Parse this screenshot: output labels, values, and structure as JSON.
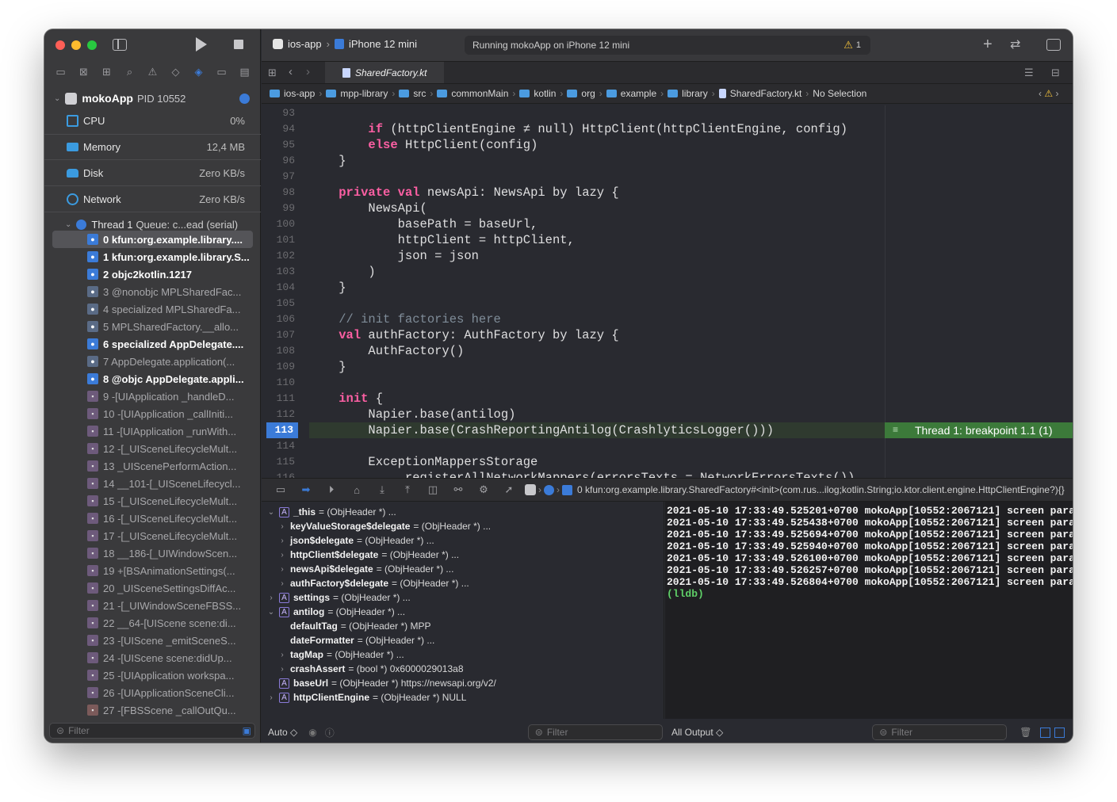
{
  "window": {
    "traffic_lights": {
      "close": "#ff5f57",
      "minimize": "#febc2e",
      "zoom": "#28c840"
    }
  },
  "toolbar": {
    "scheme": "ios-app",
    "destination": "iPhone 12 mini",
    "status": "Running mokoApp on iPhone 12 mini",
    "warning_count": "1"
  },
  "tab": {
    "title": "SharedFactory.kt"
  },
  "jumpbar": {
    "crumbs": [
      "ios-app",
      "mpp-library",
      "src",
      "commonMain",
      "kotlin",
      "org",
      "example",
      "library",
      "SharedFactory.kt",
      "No Selection"
    ]
  },
  "navigator": {
    "process_name": "mokoApp",
    "process_pid": "PID 10552",
    "gauges": [
      {
        "label": "CPU",
        "value": "0%"
      },
      {
        "label": "Memory",
        "value": "12,4 MB"
      },
      {
        "label": "Disk",
        "value": "Zero KB/s"
      },
      {
        "label": "Network",
        "value": "Zero KB/s"
      }
    ],
    "thread_label": "Thread 1",
    "thread_queue": "Queue: c...ead (serial)",
    "frames": [
      {
        "text": "0 kfun:org.example.library....",
        "kind": "user",
        "bold": true
      },
      {
        "text": "1 kfun:org.example.library.S...",
        "kind": "user",
        "bold": true
      },
      {
        "text": "2 objc2kotlin.1217",
        "kind": "user",
        "bold": true
      },
      {
        "text": "3 @nonobjc MPLSharedFac...",
        "kind": "user-dim",
        "bold": false
      },
      {
        "text": "4 specialized MPLSharedFa...",
        "kind": "user-dim",
        "bold": false
      },
      {
        "text": "5 MPLSharedFactory.__allo...",
        "kind": "user-dim",
        "bold": false
      },
      {
        "text": "6 specialized AppDelegate....",
        "kind": "user",
        "bold": true
      },
      {
        "text": "7 AppDelegate.application(...",
        "kind": "user-dim",
        "bold": false
      },
      {
        "text": "8 @objc AppDelegate.appli...",
        "kind": "user",
        "bold": true
      },
      {
        "text": "9 -[UIApplication _handleD...",
        "kind": "lib",
        "bold": false
      },
      {
        "text": "10 -[UIApplication _callIniti...",
        "kind": "lib",
        "bold": false
      },
      {
        "text": "11 -[UIApplication _runWith...",
        "kind": "lib",
        "bold": false
      },
      {
        "text": "12 -[_UISceneLifecycleMult...",
        "kind": "lib",
        "bold": false
      },
      {
        "text": "13 _UIScenePerformAction...",
        "kind": "lib",
        "bold": false
      },
      {
        "text": "14 __101-[_UISceneLifecycl...",
        "kind": "lib",
        "bold": false
      },
      {
        "text": "15 -[_UISceneLifecycleMult...",
        "kind": "lib",
        "bold": false
      },
      {
        "text": "16 -[_UISceneLifecycleMult...",
        "kind": "lib",
        "bold": false
      },
      {
        "text": "17 -[_UISceneLifecycleMult...",
        "kind": "lib",
        "bold": false
      },
      {
        "text": "18 __186-[_UIWindowScen...",
        "kind": "lib",
        "bold": false
      },
      {
        "text": "19 +[BSAnimationSettings(...",
        "kind": "lib",
        "bold": false
      },
      {
        "text": "20 _UISceneSettingsDiffAc...",
        "kind": "lib",
        "bold": false
      },
      {
        "text": "21 -[_UIWindowSceneFBSS...",
        "kind": "lib",
        "bold": false
      },
      {
        "text": "22 __64-[UIScene scene:di...",
        "kind": "lib",
        "bold": false
      },
      {
        "text": "23 -[UIScene _emitSceneS...",
        "kind": "lib",
        "bold": false
      },
      {
        "text": "24 -[UIScene scene:didUp...",
        "kind": "lib",
        "bold": false
      },
      {
        "text": "25 -[UIApplication workspa...",
        "kind": "lib",
        "bold": false
      },
      {
        "text": "26 -[UIApplicationSceneCli...",
        "kind": "lib",
        "bold": false
      },
      {
        "text": "27 -[FBSScene _callOutQu...",
        "kind": "lib2",
        "bold": false
      }
    ],
    "filter_placeholder": "Filter"
  },
  "editor": {
    "current_line": "113",
    "lines": [
      {
        "n": "93",
        "code": ""
      },
      {
        "n": "94",
        "code": "        if (httpClientEngine ≠ null) HttpClient(httpClientEngine, config)"
      },
      {
        "n": "95",
        "code": "        else HttpClient(config)"
      },
      {
        "n": "96",
        "code": "    }"
      },
      {
        "n": "97",
        "code": ""
      },
      {
        "n": "98",
        "code": "    private val newsApi: NewsApi by lazy {"
      },
      {
        "n": "99",
        "code": "        NewsApi("
      },
      {
        "n": "100",
        "code": "            basePath = baseUrl,"
      },
      {
        "n": "101",
        "code": "            httpClient = httpClient,"
      },
      {
        "n": "102",
        "code": "            json = json"
      },
      {
        "n": "103",
        "code": "        )"
      },
      {
        "n": "104",
        "code": "    }"
      },
      {
        "n": "105",
        "code": ""
      },
      {
        "n": "106",
        "code": "    // init factories here"
      },
      {
        "n": "107",
        "code": "    val authFactory: AuthFactory by lazy {"
      },
      {
        "n": "108",
        "code": "        AuthFactory()"
      },
      {
        "n": "109",
        "code": "    }"
      },
      {
        "n": "110",
        "code": ""
      },
      {
        "n": "111",
        "code": "    init {"
      },
      {
        "n": "112",
        "code": "        Napier.base(antilog)"
      },
      {
        "n": "113",
        "code": "        Napier.base(CrashReportingAntilog(CrashlyticsLogger()))"
      },
      {
        "n": "114",
        "code": ""
      },
      {
        "n": "115",
        "code": "        ExceptionMappersStorage"
      },
      {
        "n": "116",
        "code": "            .registerAllNetworkMappers(errorsTexts = NetworkErrorsTexts())"
      }
    ],
    "breakpoint_banner": "Thread 1: breakpoint 1.1 (1)"
  },
  "debug_bar": {
    "frame_text": "0 kfun:org.example.library.SharedFactory#<init>(com.rus...ilog;kotlin.String;io.ktor.client.engine.HttpClientEngine?){}"
  },
  "variables": [
    {
      "indent": 0,
      "disc": "open",
      "badge": true,
      "name": "_this",
      "value": "= (ObjHeader *) ..."
    },
    {
      "indent": 1,
      "disc": "closed",
      "badge": false,
      "name": "keyValueStorage$delegate",
      "value": "= (ObjHeader *) ..."
    },
    {
      "indent": 1,
      "disc": "closed",
      "badge": false,
      "name": "json$delegate",
      "value": "= (ObjHeader *) ..."
    },
    {
      "indent": 1,
      "disc": "closed",
      "badge": false,
      "name": "httpClient$delegate",
      "value": "= (ObjHeader *) ..."
    },
    {
      "indent": 1,
      "disc": "closed",
      "badge": false,
      "name": "newsApi$delegate",
      "value": "= (ObjHeader *) ..."
    },
    {
      "indent": 1,
      "disc": "closed",
      "badge": false,
      "name": "authFactory$delegate",
      "value": "= (ObjHeader *) ..."
    },
    {
      "indent": 0,
      "disc": "closed",
      "badge": true,
      "name": "settings",
      "value": "= (ObjHeader *) ..."
    },
    {
      "indent": 0,
      "disc": "open",
      "badge": true,
      "name": "antilog",
      "value": "= (ObjHeader *) ..."
    },
    {
      "indent": 1,
      "disc": "none",
      "badge": false,
      "name": "defaultTag",
      "value": "= (ObjHeader *) MPP"
    },
    {
      "indent": 1,
      "disc": "none",
      "badge": false,
      "name": "dateFormatter",
      "value": "= (ObjHeader *) ..."
    },
    {
      "indent": 1,
      "disc": "closed",
      "badge": false,
      "name": "tagMap",
      "value": "= (ObjHeader *) ..."
    },
    {
      "indent": 1,
      "disc": "closed",
      "badge": false,
      "name": "crashAssert",
      "value": "= (bool *) 0x6000029013a8"
    },
    {
      "indent": 0,
      "disc": "none",
      "badge": true,
      "name": "baseUrl",
      "value": "= (ObjHeader *) https://newsapi.org/v2/"
    },
    {
      "indent": 0,
      "disc": "closed",
      "badge": true,
      "name": "httpClientEngine",
      "value": "= (ObjHeader *) NULL"
    }
  ],
  "console": {
    "lines": [
      "2021-05-10 17:33:49.525201+0700 mokoApp[10552:2067121] screen paramet",
      "2021-05-10 17:33:49.525438+0700 mokoApp[10552:2067121] screen paramet",
      "2021-05-10 17:33:49.525694+0700 mokoApp[10552:2067121] screen paramet",
      "2021-05-10 17:33:49.525940+0700 mokoApp[10552:2067121] screen paramet",
      "2021-05-10 17:33:49.526100+0700 mokoApp[10552:2067121] screen paramet",
      "2021-05-10 17:33:49.526257+0700 mokoApp[10552:2067121] screen paramet",
      "2021-05-10 17:33:49.526804+0700 mokoApp[10552:2067121] screen paramet"
    ],
    "prompt": "(lldb)"
  },
  "bottom": {
    "auto_label": "Auto ◇",
    "vars_filter": "Filter",
    "output_label": "All Output ◇",
    "console_filter": "Filter"
  }
}
